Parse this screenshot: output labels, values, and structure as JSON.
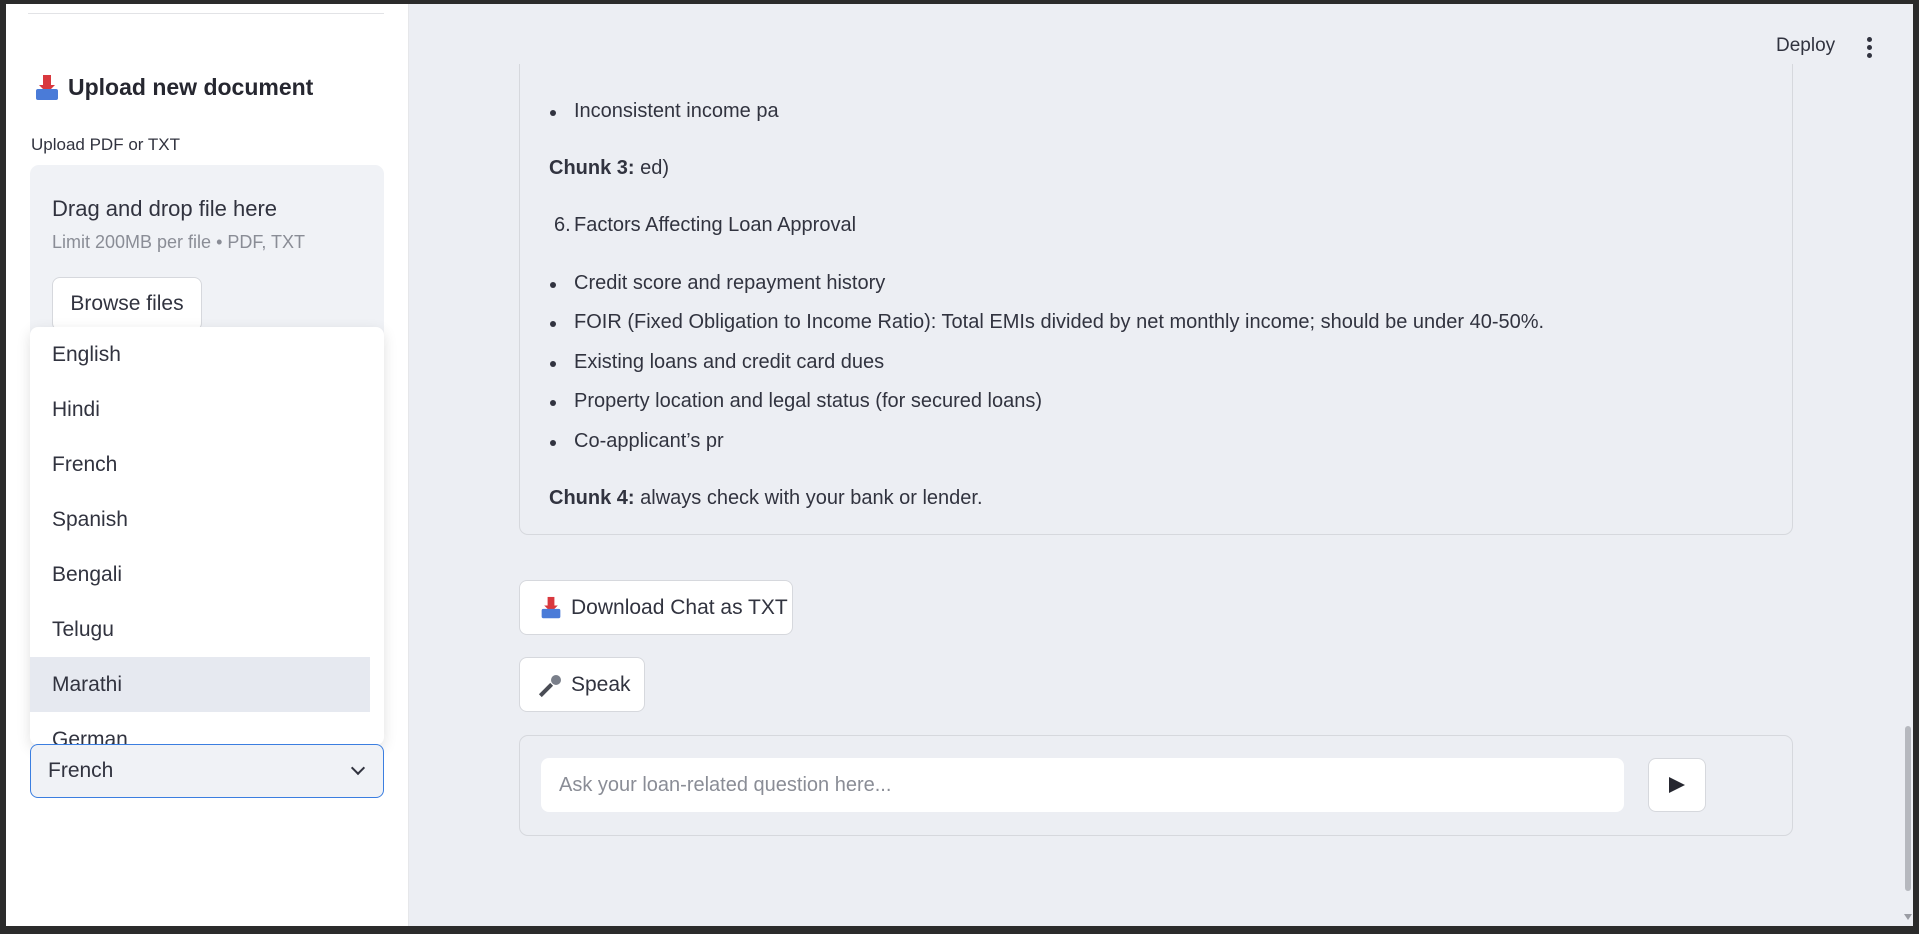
{
  "sidebar": {
    "upload_title": "Upload new document",
    "upload_label": "Upload PDF or TXT",
    "dropzone": {
      "title": "Drag and drop file here",
      "limit": "Limit 200MB per file • PDF, TXT",
      "browse_label": "Browse files"
    },
    "language_options": [
      "English",
      "Hindi",
      "French",
      "Spanish",
      "Bengali",
      "Telugu",
      "Marathi",
      "German"
    ],
    "language_highlighted": "Marathi",
    "language_selected": "French"
  },
  "header": {
    "deploy_label": "Deploy"
  },
  "chunks": {
    "bullet_top": "Inconsistent income pa",
    "chunk3_label": "Chunk 3:",
    "chunk3_text": "ed)",
    "numbered_num": "6.",
    "numbered_text": "Factors Affecting Loan Approval",
    "bullets": [
      "Credit score and repayment history",
      "FOIR (Fixed Obligation to Income Ratio): Total EMIs divided by net monthly income; should be under 40-50%.",
      "Existing loans and credit card dues",
      "Property location and legal status (for secured loans)",
      "Co-applicant’s pr"
    ],
    "chunk4_label": "Chunk 4:",
    "chunk4_text": "always check with your bank or lender."
  },
  "actions": {
    "download_label": "Download Chat as TXT",
    "speak_label": "Speak"
  },
  "chat": {
    "placeholder": "Ask your loan-related question here...",
    "value": ""
  },
  "icons": {
    "download": "inbox-tray-icon",
    "speak": "microphone-icon",
    "send": "send-arrow-icon",
    "menu": "kebab-menu-icon"
  }
}
